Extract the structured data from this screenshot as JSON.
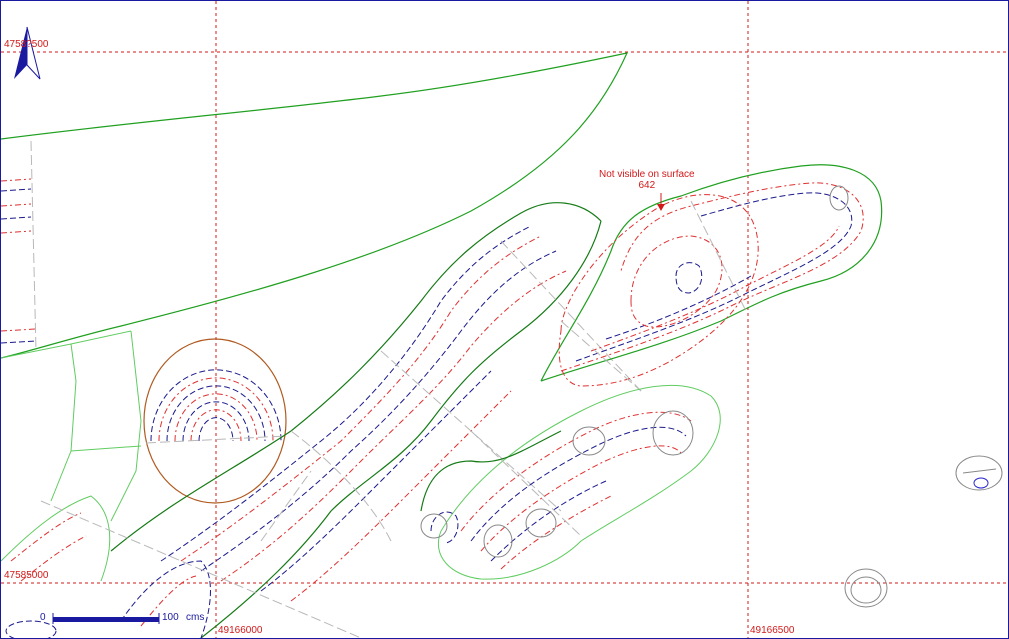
{
  "map": {
    "grid_labels": {
      "y_top": "4758?500",
      "y_bottom": "47585000",
      "x_left": "49166000",
      "x_right": "49166500"
    },
    "annotation": {
      "line1": "Not visible on surface",
      "line2": "642"
    },
    "scale_bar": {
      "start_label": "0",
      "end_label": "100",
      "unit": "cms"
    },
    "colors": {
      "grid": "#d21a1a",
      "outline": "#20a020",
      "contour_red": "#e03030",
      "contour_blue": "#1a1a8c",
      "feature_brown": "#b05a20",
      "north_arrow": "#1a1aa0"
    },
    "icons": [
      "north-arrow-icon"
    ]
  }
}
